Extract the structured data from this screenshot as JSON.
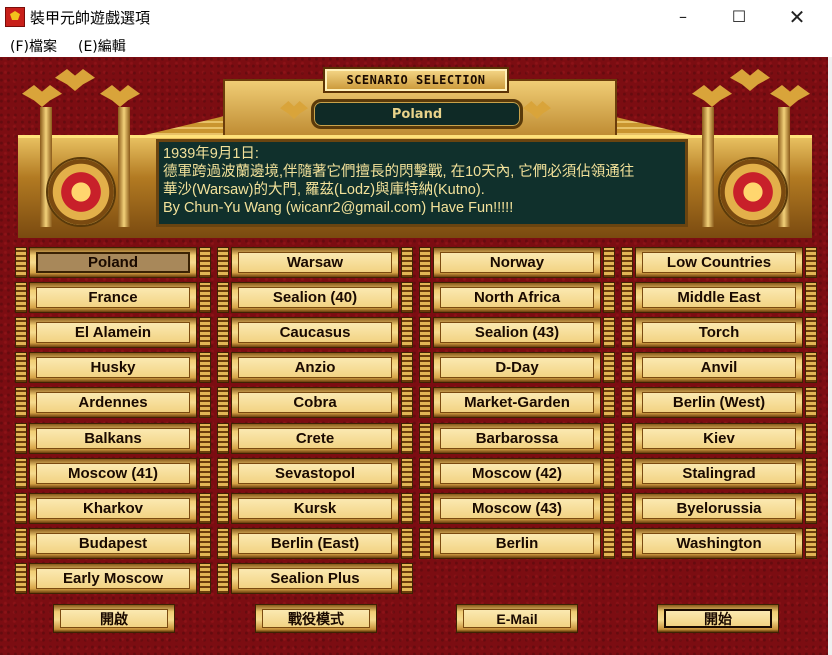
{
  "window": {
    "title": "裝甲元帥遊戲選項",
    "minimize": "–",
    "maximize": "☐",
    "close": "✕"
  },
  "menu": {
    "file": "(F)檔案",
    "edit": "(E)編輯"
  },
  "header": {
    "scenario_label": "SCENARIO SELECTION",
    "selected_scenario": "Poland"
  },
  "description": {
    "line1": "1939年9月1日:",
    "line2": "德軍跨過波蘭邊境,伴隨著它們擅長的閃擊戰, 在10天內, 它們必須佔領通往",
    "line3": "華沙(Warsaw)的大門, 羅茲(Lodz)與庫特納(Kutno).",
    "line4": "By Chun-Yu Wang (wicanr2@gmail.com) Have Fun!!!!!"
  },
  "scenarios": {
    "col1": [
      "Poland",
      "France",
      "El Alamein",
      "Husky",
      "Ardennes",
      "Balkans",
      "Moscow (41)",
      "Kharkov",
      "Budapest",
      "Early Moscow"
    ],
    "col2": [
      "Warsaw",
      "Sealion (40)",
      "Caucasus",
      "Anzio",
      "Cobra",
      "Crete",
      "Sevastopol",
      "Kursk",
      "Berlin (East)",
      "Sealion Plus"
    ],
    "col3": [
      "Norway",
      "North Africa",
      "Sealion (43)",
      "D-Day",
      "Market-Garden",
      "Barbarossa",
      "Moscow (42)",
      "Moscow (43)",
      "Berlin"
    ],
    "col4": [
      "Low Countries",
      "Middle East",
      "Torch",
      "Anvil",
      "Berlin (West)",
      "Kiev",
      "Stalingrad",
      "Byelorussia",
      "Washington"
    ]
  },
  "bottom": {
    "open": "開啟",
    "campaign": "戰役模式",
    "email": "E-Mail",
    "start": "開始"
  },
  "colors": {
    "background": "#7c0d12",
    "gold": "#f2d383",
    "panel": "#10302c",
    "panel_text": "#f2e19a"
  }
}
